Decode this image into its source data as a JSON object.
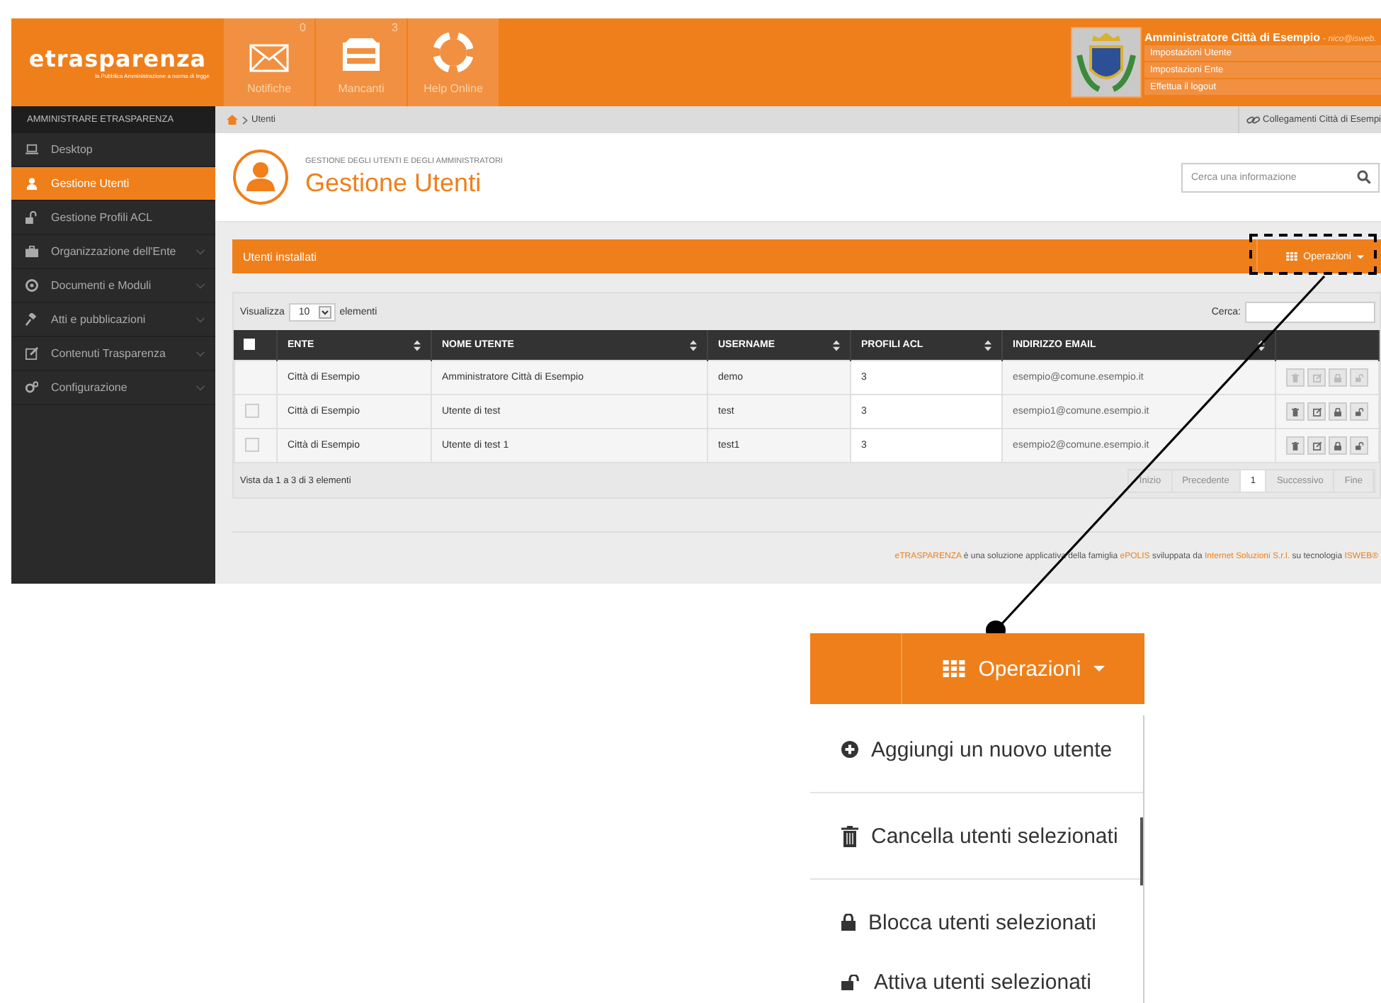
{
  "logo": {
    "name": "etrasparenza",
    "tagline": "la Pubblica Amministrazione a norma di legge"
  },
  "top_nav": [
    {
      "label": "Notifiche",
      "count": "0",
      "kind": "envelope"
    },
    {
      "label": "Mancanti",
      "count": "3",
      "kind": "cabinet"
    },
    {
      "label": "Help Online",
      "kind": "lifebuoy"
    }
  ],
  "user": {
    "name": "Amministratore Città di Esempio",
    "email": "- nico@isweb.",
    "menu": [
      "Impostazioni Utente",
      "Impostazioni Ente",
      "Effettua il logout"
    ]
  },
  "sidebar": {
    "heading": "AMMINISTRARE ETRASPARENZA",
    "items": [
      {
        "label": "Desktop",
        "kind": "laptop",
        "selected": false,
        "expandable": false
      },
      {
        "label": "Gestione Utenti",
        "kind": "user",
        "selected": true,
        "expandable": false
      },
      {
        "label": "Gestione Profili ACL",
        "kind": "unlock",
        "selected": false,
        "expandable": false
      },
      {
        "label": "Organizzazione dell'Ente",
        "kind": "briefcase",
        "selected": false,
        "expandable": true
      },
      {
        "label": "Documenti e Moduli",
        "kind": "disc",
        "selected": false,
        "expandable": true
      },
      {
        "label": "Atti e pubblicazioni",
        "kind": "gavel",
        "selected": false,
        "expandable": true
      },
      {
        "label": "Contenuti Trasparenza",
        "kind": "edit",
        "selected": false,
        "expandable": true
      },
      {
        "label": "Configurazione",
        "kind": "gears",
        "selected": false,
        "expandable": true
      }
    ]
  },
  "breadcrumb": {
    "current": "Utenti",
    "links": "Collegamenti Città di Esempi"
  },
  "page": {
    "subtitle": "GESTIONE DEGLI UTENTI E DEGLI AMMINISTRATORI",
    "title": "Gestione Utenti",
    "search_placeholder": "Cerca una informazione"
  },
  "panel": {
    "title": "Utenti installati",
    "operations_button": "Operazioni"
  },
  "table": {
    "show_label": "Visualizza",
    "page_size": "10",
    "show_suffix": "elementi",
    "search_label": "Cerca:",
    "select_all_checked": false,
    "columns": [
      "ENTE",
      "NOME UTENTE",
      "USERNAME",
      "PROFILI ACL",
      "INDIRIZZO EMAIL"
    ],
    "rows": [
      {
        "cells": [
          "Città di Esempio",
          "Amministratore Città di Esempio",
          "demo",
          "3",
          "esempio@comune.esempio.it"
        ],
        "disabled": true
      },
      {
        "cells": [
          "Città di Esempio",
          "Utente di test",
          "test",
          "3",
          "esempio1@comune.esempio.it"
        ],
        "checked": false,
        "disabled": false
      },
      {
        "cells": [
          "Città di Esempio",
          "Utente di test 1",
          "test1",
          "3",
          "esempio2@comune.esempio.it"
        ],
        "checked": false,
        "disabled": false
      }
    ],
    "info": "Vista da 1 a 3 di 3 elementi",
    "pagination": [
      {
        "label": "Inizio",
        "selected": false,
        "disabled": true
      },
      {
        "label": "Precedente",
        "selected": false,
        "disabled": true
      },
      {
        "label": "1",
        "selected": true,
        "disabled": false
      },
      {
        "label": "Successivo",
        "selected": false,
        "disabled": true
      },
      {
        "label": "Fine",
        "selected": false,
        "disabled": true
      }
    ]
  },
  "footer": [
    {
      "text": "eTRASPARENZA",
      "link": true
    },
    {
      "text": " è una soluzione applicativa della famiglia ",
      "link": false
    },
    {
      "text": "ePOLIS",
      "link": true
    },
    {
      "text": " sviluppata da ",
      "link": false
    },
    {
      "text": "Internet Soluzioni S.r.l.",
      "link": true
    },
    {
      "text": " su tecnologia ",
      "link": false
    },
    {
      "text": "ISWEB®",
      "link": true
    }
  ],
  "callout": {
    "button": "Operazioni",
    "menu": [
      {
        "label": "Aggiungi un nuovo utente",
        "kind": "add",
        "divider_after": true
      },
      {
        "label": "Cancella utenti selezionati",
        "kind": "delete",
        "divider_after": true
      },
      {
        "label": "Blocca utenti selezionati",
        "kind": "lock",
        "divider_after": false
      },
      {
        "label": "Attiva utenti selezionati",
        "kind": "unlock",
        "divider_after": false
      }
    ]
  }
}
